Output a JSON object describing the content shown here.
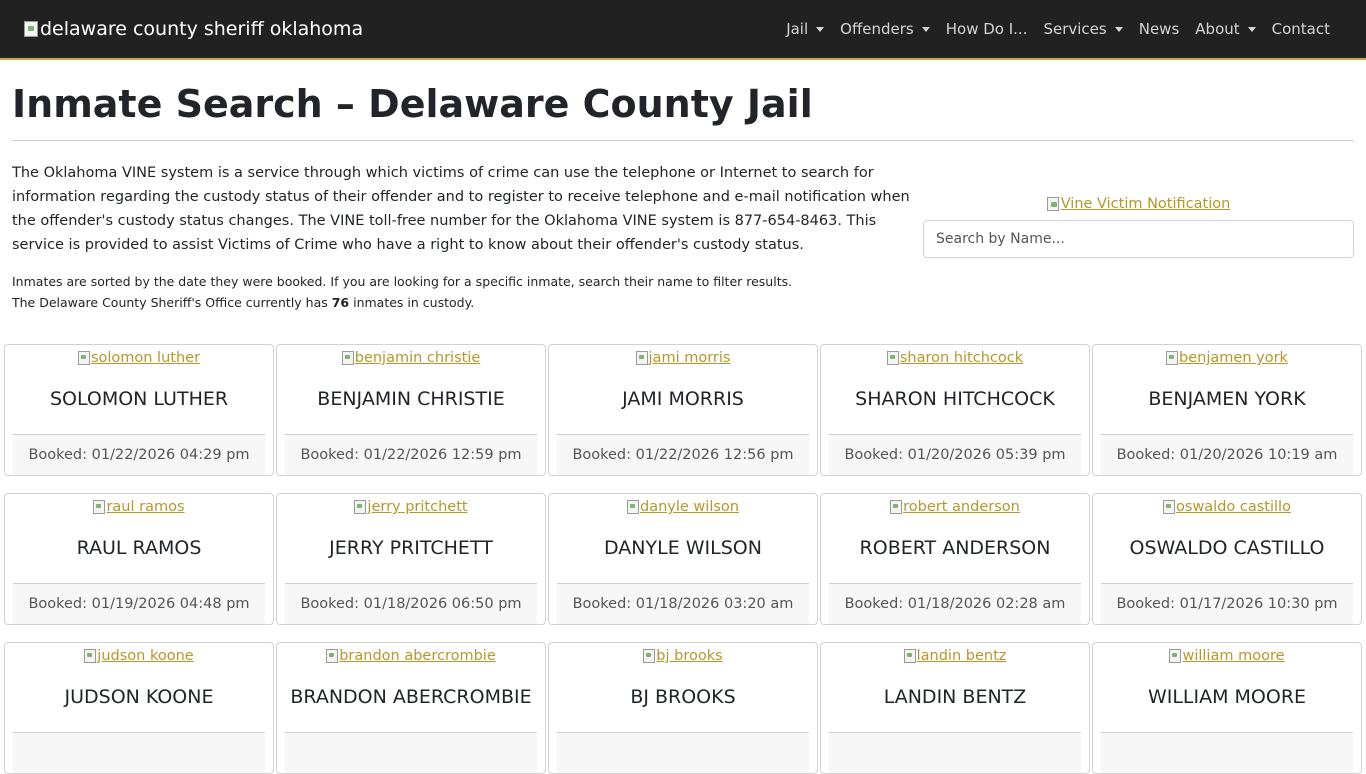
{
  "navbar": {
    "brand_alt": "delaware county sheriff oklahoma",
    "items": [
      {
        "label": "Jail",
        "dropdown": true
      },
      {
        "label": "Offenders",
        "dropdown": true
      },
      {
        "label": "How Do I...",
        "dropdown": false
      },
      {
        "label": "Services",
        "dropdown": true
      },
      {
        "label": "News",
        "dropdown": false
      },
      {
        "label": "About",
        "dropdown": true
      },
      {
        "label": "Contact",
        "dropdown": false
      }
    ]
  },
  "page": {
    "title": "Inmate Search – Delaware County Jail",
    "intro": "The Oklahoma VINE system is a service through which victims of crime can use the telephone or Internet to search for information regarding the custody status of their offender and to register to receive telephone and e-mail notification when the offender's custody status changes. The VINE toll-free number for the Oklahoma VINE system is 877-654-8463. This service is provided to assist Victims of Crime who have a right to know about their offender's custody status.",
    "sort_note": "Inmates are sorted by the date they were booked. If you are looking for a specific inmate, search their name to filter results.",
    "count_prefix": "The Delaware County Sheriff's Office currently has ",
    "count": "76",
    "count_suffix": " inmates in custody.",
    "vine_alt": "Vine Victim Notification",
    "search_placeholder": "Search by Name..."
  },
  "colors": {
    "navbar_bg": "#212121",
    "accent": "#b5982a",
    "navbar_border": "#c9a74a"
  },
  "inmates": [
    {
      "photo_alt": "solomon luther",
      "name": "SOLOMON LUTHER",
      "booked": "Booked: 01/22/2026 04:29 pm"
    },
    {
      "photo_alt": "benjamin christie",
      "name": "BENJAMIN CHRISTIE",
      "booked": "Booked: 01/22/2026 12:59 pm"
    },
    {
      "photo_alt": "jami morris",
      "name": "JAMI MORRIS",
      "booked": "Booked: 01/22/2026 12:56 pm"
    },
    {
      "photo_alt": "sharon hitchcock",
      "name": "SHARON HITCHCOCK",
      "booked": "Booked: 01/20/2026 05:39 pm"
    },
    {
      "photo_alt": "benjamen york",
      "name": "BENJAMEN YORK",
      "booked": "Booked: 01/20/2026 10:19 am"
    },
    {
      "photo_alt": "raul ramos",
      "name": "RAUL RAMOS",
      "booked": "Booked: 01/19/2026 04:48 pm"
    },
    {
      "photo_alt": "jerry pritchett",
      "name": "JERRY PRITCHETT",
      "booked": "Booked: 01/18/2026 06:50 pm"
    },
    {
      "photo_alt": "danyle wilson",
      "name": "DANYLE WILSON",
      "booked": "Booked: 01/18/2026 03:20 am"
    },
    {
      "photo_alt": "robert anderson",
      "name": "ROBERT ANDERSON",
      "booked": "Booked: 01/18/2026 02:28 am"
    },
    {
      "photo_alt": "oswaldo castillo",
      "name": "OSWALDO CASTILLO",
      "booked": "Booked: 01/17/2026 10:30 pm"
    },
    {
      "photo_alt": "judson koone",
      "name": "JUDSON KOONE",
      "booked": ""
    },
    {
      "photo_alt": "brandon abercrombie",
      "name": "BRANDON ABERCROMBIE",
      "booked": ""
    },
    {
      "photo_alt": "bj brooks",
      "name": "BJ BROOKS",
      "booked": ""
    },
    {
      "photo_alt": "landin bentz",
      "name": "LANDIN BENTZ",
      "booked": ""
    },
    {
      "photo_alt": "william moore",
      "name": "WILLIAM MOORE",
      "booked": ""
    }
  ]
}
